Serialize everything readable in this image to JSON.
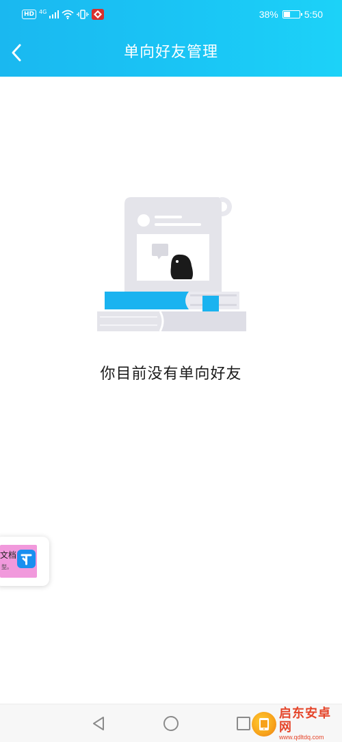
{
  "status_bar": {
    "hd": "HD",
    "network": "4G",
    "battery_text": "38%",
    "battery_level": 0.38,
    "time": "5:50"
  },
  "header": {
    "title": "单向好友管理",
    "back_icon": "chevron-left-icon"
  },
  "empty_state": {
    "message": "你目前没有单向好友",
    "illustration": "document-books-penguin-illustration"
  },
  "floating_widget": {
    "line1": "文档",
    "line2": "型。",
    "icon": "doc-app-icon"
  },
  "system_nav": {
    "back_icon": "triangle-back-icon",
    "home_icon": "circle-home-icon",
    "recents_icon": "square-recents-icon"
  },
  "watermark": {
    "title": "启东安卓网",
    "url": "www.qdltdq.com"
  },
  "colors": {
    "header_gradient_start": "#1ab8f0",
    "header_gradient_end": "#1cd2f8",
    "book_blue": "#1ab3f0",
    "illustration_gray": "#e4e4ea",
    "watermark_red": "#e5452a"
  }
}
